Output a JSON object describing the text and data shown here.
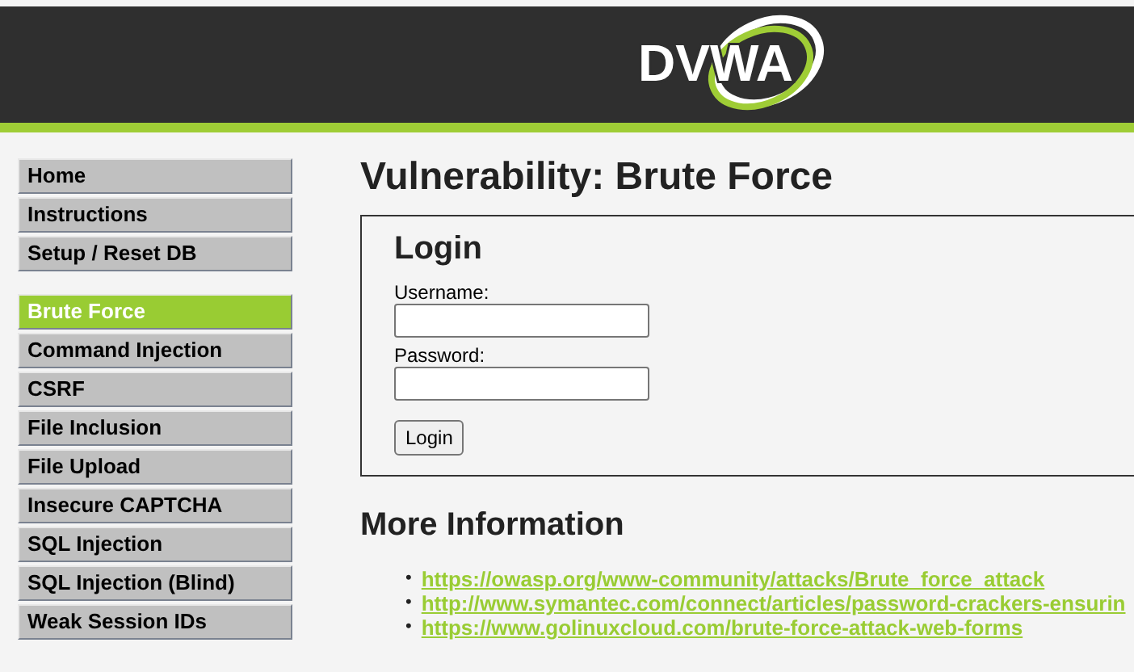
{
  "header": {
    "logo": "DVWA"
  },
  "menu": [
    {
      "items": [
        {
          "label": "Home",
          "selected": false
        },
        {
          "label": "Instructions",
          "selected": false
        },
        {
          "label": "Setup / Reset DB",
          "selected": false
        }
      ]
    },
    {
      "items": [
        {
          "label": "Brute Force",
          "selected": true
        },
        {
          "label": "Command Injection",
          "selected": false
        },
        {
          "label": "CSRF",
          "selected": false
        },
        {
          "label": "File Inclusion",
          "selected": false
        },
        {
          "label": "File Upload",
          "selected": false
        },
        {
          "label": "Insecure CAPTCHA",
          "selected": false
        },
        {
          "label": "SQL Injection",
          "selected": false
        },
        {
          "label": "SQL Injection (Blind)",
          "selected": false
        },
        {
          "label": "Weak Session IDs",
          "selected": false
        }
      ]
    }
  ],
  "title": "Vulnerability: Brute Force",
  "login": {
    "heading": "Login",
    "fields": [
      {
        "label": "Username:"
      },
      {
        "label": "Password:"
      }
    ],
    "button": "Login"
  },
  "more_info": {
    "heading": "More Information",
    "links": [
      {
        "marker": "•",
        "text": "https://owasp.org/www-community/attacks/Brute_force_attack"
      },
      {
        "marker": "•",
        "text": "http://www.symantec.com/connect/articles/password-crackers-ensurin"
      },
      {
        "marker": "•",
        "text": "https://www.golinuxcloud.com/brute-force-attack-web-forms"
      }
    ]
  }
}
